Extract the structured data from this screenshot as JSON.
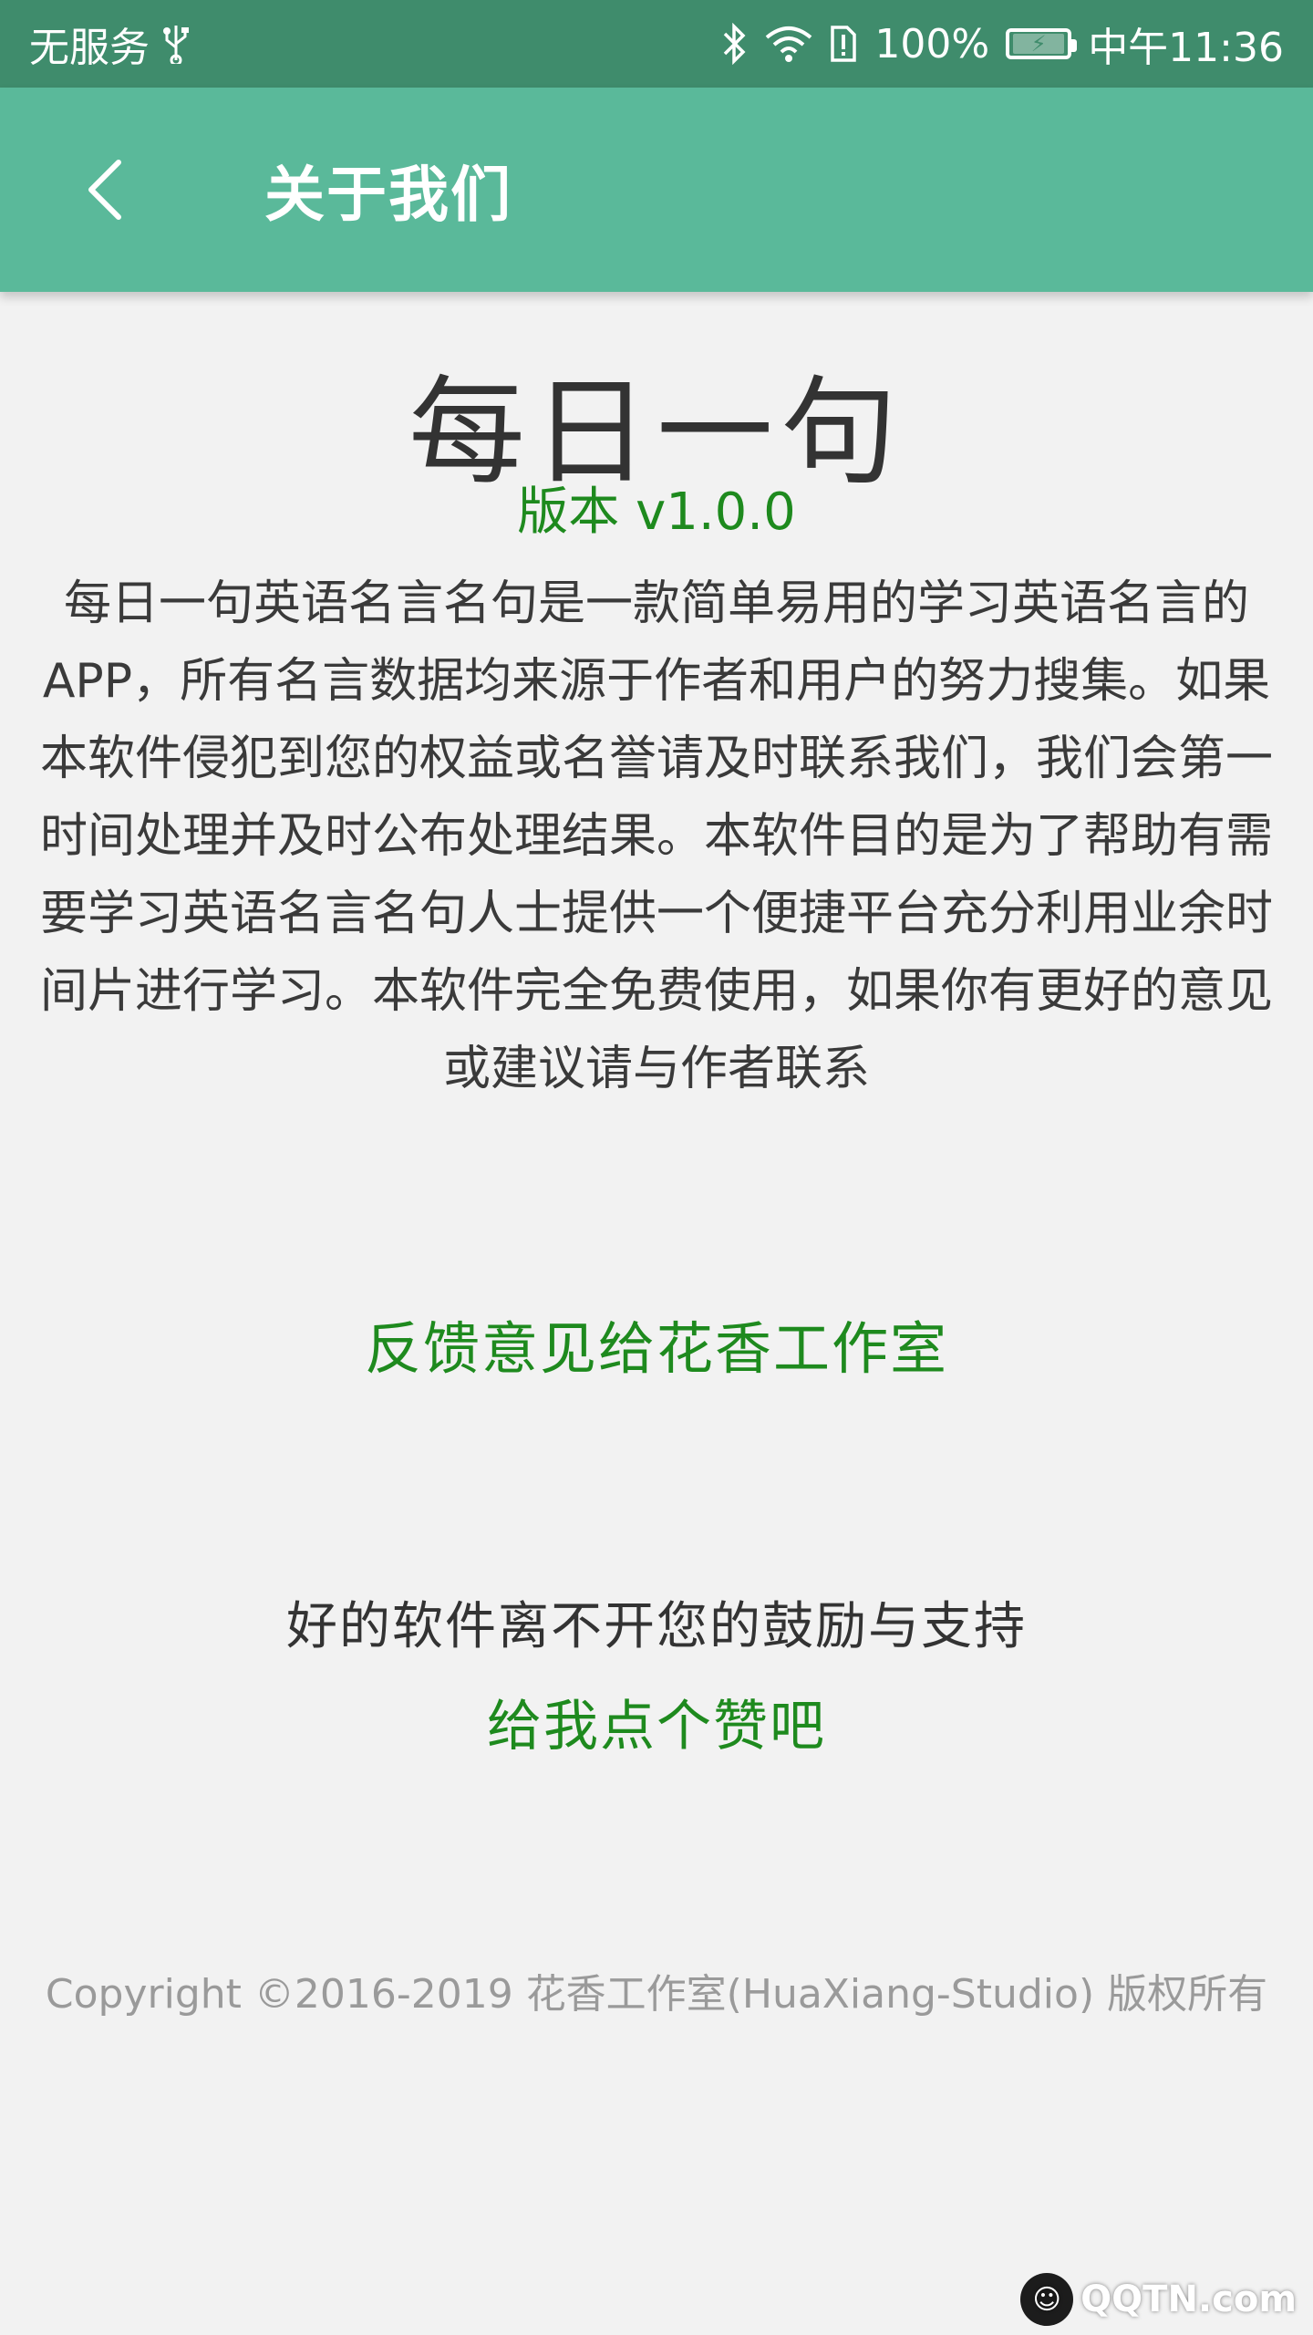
{
  "status_bar": {
    "carrier": "无服务",
    "battery": "100%",
    "time": "中午11:36"
  },
  "app_bar": {
    "title": "关于我们"
  },
  "about": {
    "app_name": "每日一句",
    "version": "版本 v1.0.0",
    "description": "每日一句英语名言名句是一款简单易用的学习英语名言的APP，所有名言数据均来源于作者和用户的努力搜集。如果本软件侵犯到您的权益或名誉请及时联系我们，我们会第一时间处理并及时公布处理结果。本软件目的是为了帮助有需要学习英语名言名句人士提供一个便捷平台充分利用业余时间片进行学习。本软件完全免费使用，如果你有更好的意见或建议请与作者联系",
    "feedback_link": "反馈意见给花香工作室",
    "support_text": "好的软件离不开您的鼓励与支持",
    "like_link": "给我点个赞吧",
    "copyright": "Copyright ©2016-2019 花香工作室(HuaXiang-Studio) 版权所有"
  },
  "watermark": {
    "text": "QQTN.com"
  },
  "colors": {
    "status_bar": "#3f8c6c",
    "app_bar": "#5ab99a",
    "link_green": "#1e8a1e",
    "background": "#f2f2f2"
  }
}
